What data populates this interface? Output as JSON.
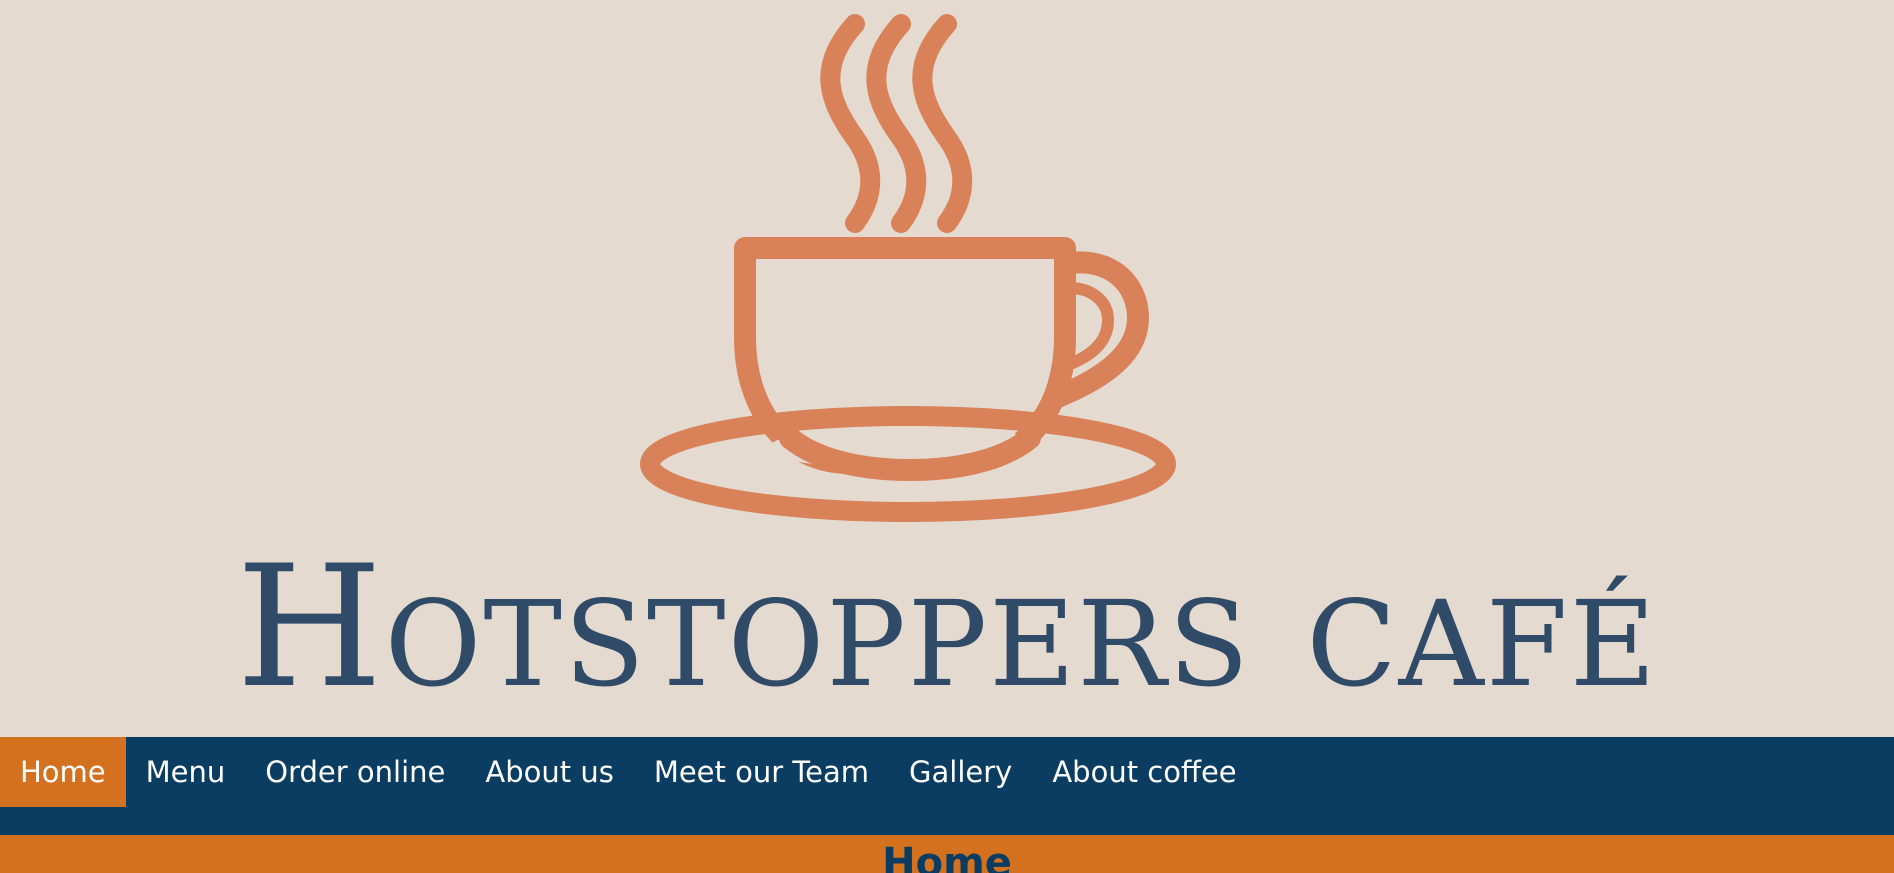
{
  "brand": {
    "title": "Hotstoppers café",
    "logo_icon": "coffee-cup-icon",
    "logo_color": "#d98259",
    "title_color": "#2f4b68",
    "background": "#e4dad0"
  },
  "nav": {
    "background": "#0b3c61",
    "active_color": "#d3711e",
    "items": [
      {
        "label": "Home",
        "active": true
      },
      {
        "label": "Menu",
        "active": false
      },
      {
        "label": "Order online",
        "active": false
      },
      {
        "label": "About us",
        "active": false
      },
      {
        "label": "Meet our Team",
        "active": false
      },
      {
        "label": "Gallery",
        "active": false
      },
      {
        "label": "About coffee",
        "active": false
      }
    ]
  },
  "section": {
    "heading": "Home",
    "background": "#d3711e"
  }
}
